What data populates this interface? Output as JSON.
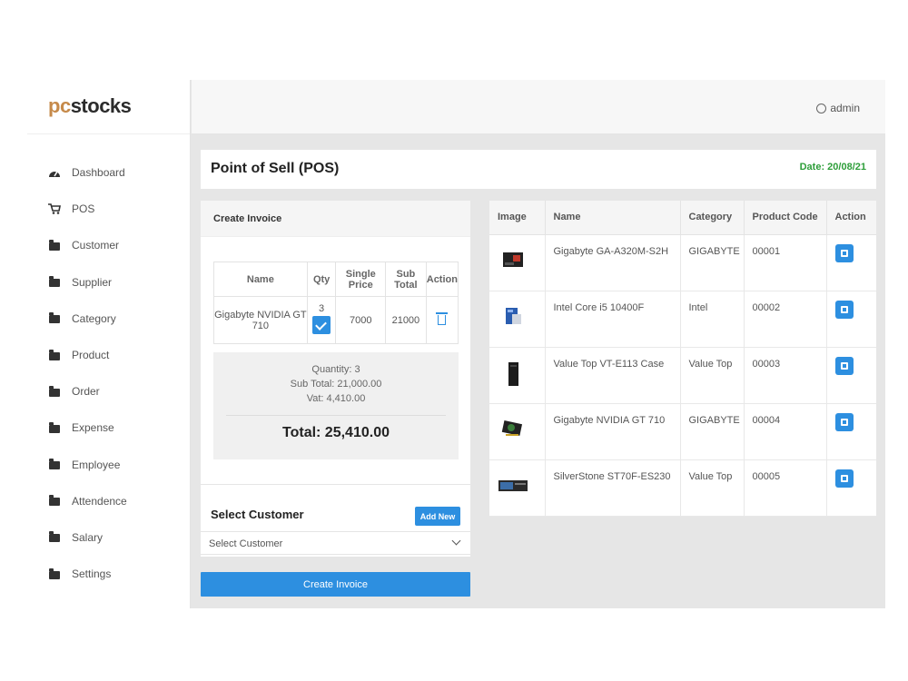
{
  "brand": {
    "part1": "pc",
    "part2": "stocks"
  },
  "topbar": {
    "user": "admin"
  },
  "sidebar": {
    "items": [
      {
        "label": "Dashboard",
        "icon": "dashboard-icon"
      },
      {
        "label": "POS",
        "icon": "cart-icon"
      },
      {
        "label": "Customer",
        "icon": "folder-icon"
      },
      {
        "label": "Supplier",
        "icon": "folder-icon"
      },
      {
        "label": "Category",
        "icon": "folder-icon"
      },
      {
        "label": "Product",
        "icon": "folder-icon"
      },
      {
        "label": "Order",
        "icon": "folder-icon"
      },
      {
        "label": "Expense",
        "icon": "folder-icon"
      },
      {
        "label": "Employee",
        "icon": "folder-icon"
      },
      {
        "label": "Attendence",
        "icon": "folder-icon"
      },
      {
        "label": "Salary",
        "icon": "folder-icon"
      },
      {
        "label": "Settings",
        "icon": "folder-icon"
      }
    ]
  },
  "header": {
    "title": "Point of Sell (POS)",
    "date": "Date: 20/08/21"
  },
  "invoice": {
    "title": "Create Invoice",
    "columns": [
      "Name",
      "Qty",
      "Single Price",
      "Sub Total",
      "Action"
    ],
    "rows": [
      {
        "name": "Gigabyte NVIDIA GT 710",
        "qty": "3",
        "price": "7000",
        "subtotal": "21000"
      }
    ],
    "summary": {
      "quantity": "Quantity: 3",
      "subtotal": "Sub Total: 21,000.00",
      "vat": "Vat: 4,410.00",
      "total": "Total: 25,410.00"
    },
    "customer_label": "Select Customer",
    "add_new": "Add New",
    "select_value": "Select Customer",
    "create_button": "Create Invoice"
  },
  "products": {
    "columns": [
      "Image",
      "Name",
      "Category",
      "Product Code",
      "Action"
    ],
    "rows": [
      {
        "name": "Gigabyte GA-A320M-S2H",
        "category": "GIGABYTE",
        "code": "00001"
      },
      {
        "name": "Intel Core i5 10400F",
        "category": "Intel",
        "code": "00002"
      },
      {
        "name": "Value Top VT-E113 Case",
        "category": "Value Top",
        "code": "00003"
      },
      {
        "name": "Gigabyte NVIDIA GT 710",
        "category": "GIGABYTE",
        "code": "00004"
      },
      {
        "name": "SilverStone ST70F-ES230",
        "category": "Value Top",
        "code": "00005"
      }
    ]
  },
  "colors": {
    "accent": "#2d8fe0",
    "date_green": "#2e9e3a",
    "brand_pc": "#c68a4a"
  }
}
